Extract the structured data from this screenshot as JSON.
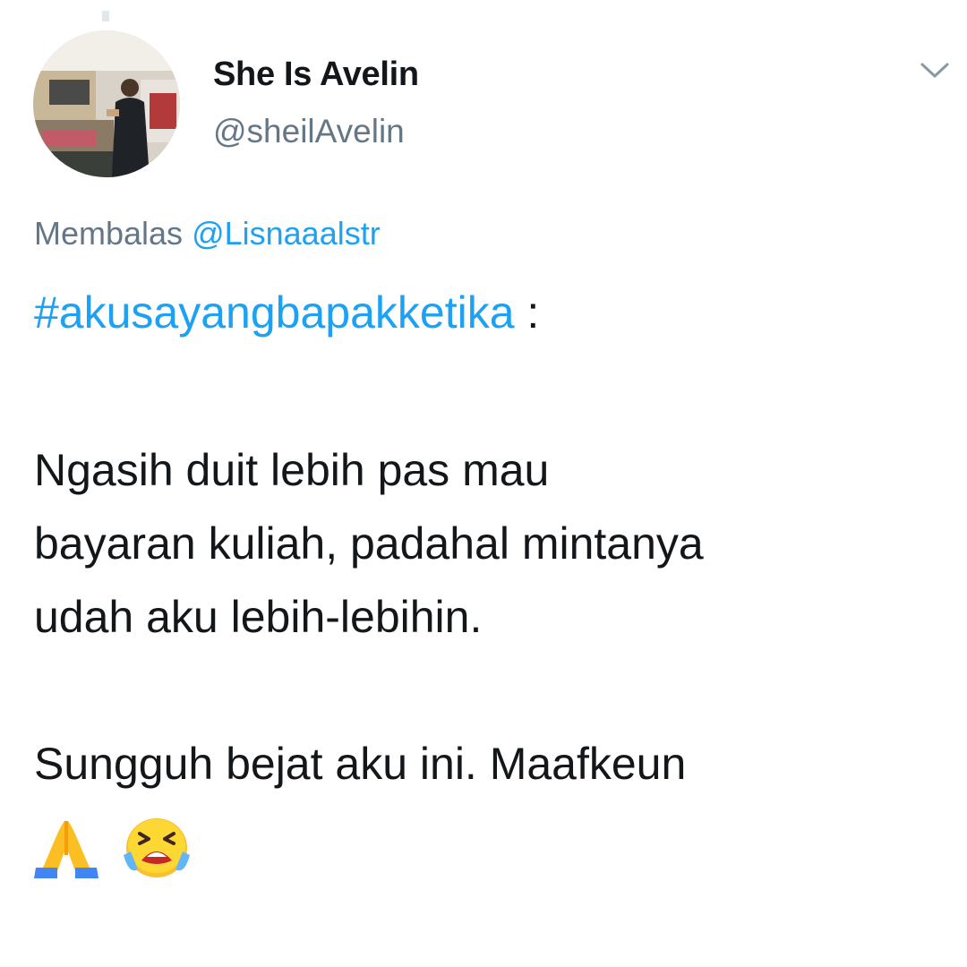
{
  "tweet": {
    "author": {
      "display_name": "She Is Avelin",
      "handle": "@sheilAvelin"
    },
    "reply_to": {
      "prefix": "Membalas",
      "mention": "@Lisnaaalstr"
    },
    "hashtag": "#akusayangbapakketika",
    "hashtag_suffix": " :",
    "body_lines": [
      "Ngasih duit lebih pas mau",
      "bayaran kuliah, padahal mintanya",
      "udah aku lebih-lebihin.",
      "Sungguh bejat aku ini. Maafkeun"
    ],
    "emojis": [
      "folded-hands-icon",
      "loudly-crying-face-icon"
    ]
  },
  "colors": {
    "link": "#1da1f2",
    "secondary_text": "#657786",
    "primary_text": "#14171a"
  }
}
